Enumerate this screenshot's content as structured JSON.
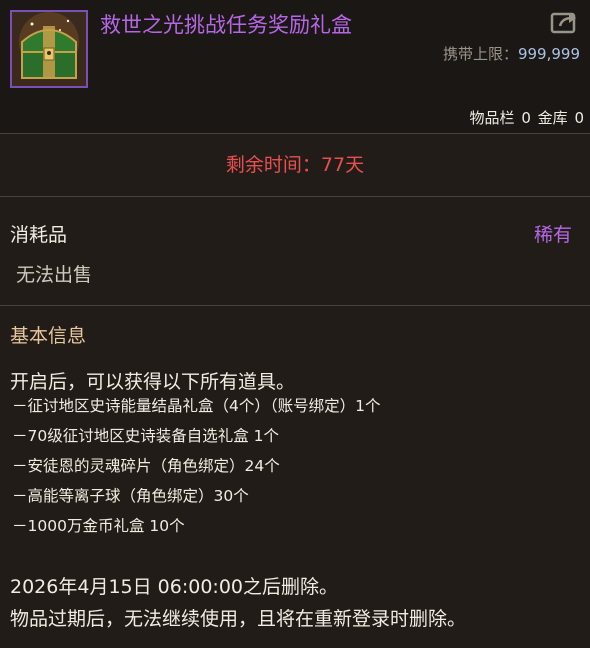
{
  "item": {
    "title": "救世之光挑战任务奖励礼盒",
    "carry_limit_label": "携带上限：",
    "carry_limit_value": "999,999",
    "inventory_label": "物品栏",
    "inventory_count": "0",
    "bank_label": "金库",
    "bank_count": "0",
    "icon": "treasure-chest-icon",
    "share_icon": "share-icon"
  },
  "expiry": {
    "text": "剩余时间：77天"
  },
  "meta": {
    "category": "消耗品",
    "rarity": "稀有",
    "trade": "无法出售"
  },
  "info": {
    "section_title": "基本信息",
    "intro": "开启后，可以获得以下所有道具。",
    "rewards": [
      "－征讨地区史诗能量结晶礼盒（4个）（账号绑定）1个",
      "－70级征讨地区史诗装备自选礼盒 1个",
      "－安徒恩的灵魂碎片（角色绑定）24个",
      "－高能等离子球（角色绑定）30个",
      "－1000万金币礼盒 10个"
    ],
    "delete_date": "2026年4月15日 06:00:00之后删除。",
    "expire_note": "物品过期后，无法继续使用，且将在重新登录时删除。"
  },
  "colors": {
    "title": "#b667e6",
    "rarity": "#b667e6",
    "expiry": "#e8504f",
    "section_title": "#e7c79c",
    "carry_value": "#a9c3e3"
  }
}
